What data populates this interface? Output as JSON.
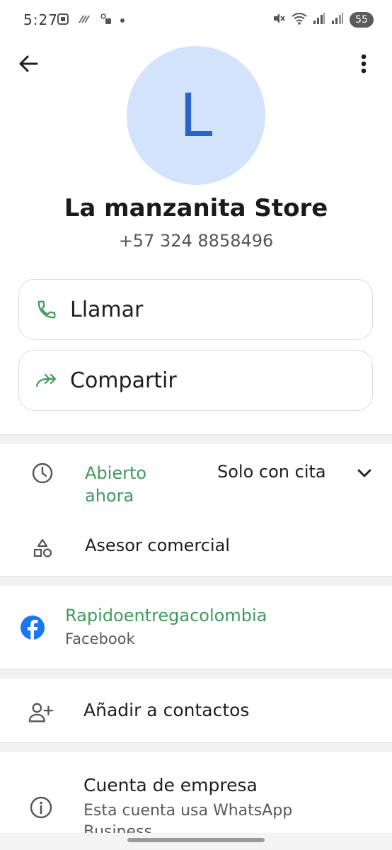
{
  "status_bar": {
    "time": "5:27",
    "battery": "55",
    "icons": [
      "screenshot-icon",
      "nfc-icon",
      "lock-icon",
      "mute-icon",
      "wifi-icon",
      "signal-icon",
      "signal-icon-2"
    ]
  },
  "header": {
    "back_icon": "arrow-left-icon",
    "menu_icon": "more-vert-icon"
  },
  "contact": {
    "avatar_letter": "L",
    "avatar_bg": "#d3e3fb",
    "avatar_fg": "#2c63c6",
    "name": "La manzanita Store",
    "phone": "+57 324 8858496"
  },
  "actions": {
    "call_label": "Llamar",
    "share_label": "Compartir"
  },
  "business_info": {
    "hours_status": "Abierto ahora",
    "hours_detail": "Solo con cita",
    "category": "Asesor comercial"
  },
  "social": {
    "name": "Rapidoentregacolombia",
    "platform": "Facebook"
  },
  "add_contact": {
    "label": "Añadir a contactos"
  },
  "business_account": {
    "title": "Cuenta de empresa",
    "subtitle": "Esta cuenta usa WhatsApp Business"
  },
  "colors": {
    "accent_green": "#3e9b5c",
    "facebook_blue": "#1877f2"
  }
}
